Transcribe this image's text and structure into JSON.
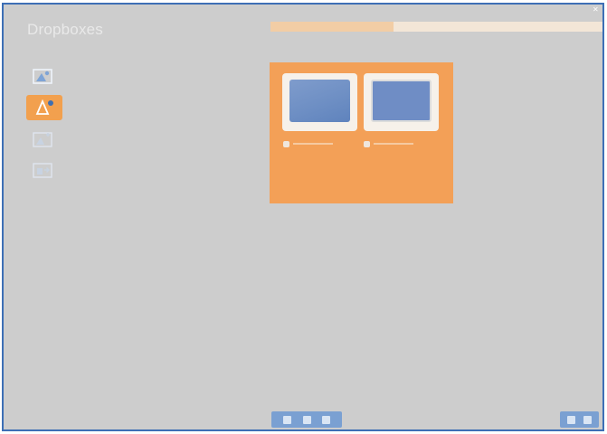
{
  "header": {
    "title": "Dropboxes",
    "progress_fraction": 0.37
  },
  "sidebar": {
    "items": [
      {
        "icon": "photo-tool-icon",
        "selected": false
      },
      {
        "icon": "alert-photo-icon",
        "selected": true
      },
      {
        "icon": "photo-add-icon",
        "selected": false
      },
      {
        "icon": "photo-share-icon",
        "selected": false
      }
    ]
  },
  "panel": {
    "accent": "#f3a057",
    "items": [
      {
        "icon": "dock-photo-icon"
      },
      {
        "icon": "monitor-photo-icon"
      }
    ]
  },
  "controls": {
    "bottom_bar_icons": [
      "down-arrow-icon",
      "info-icon",
      "grid-icon"
    ],
    "corner_icons": [
      "back-icon",
      "forward-icon"
    ]
  }
}
